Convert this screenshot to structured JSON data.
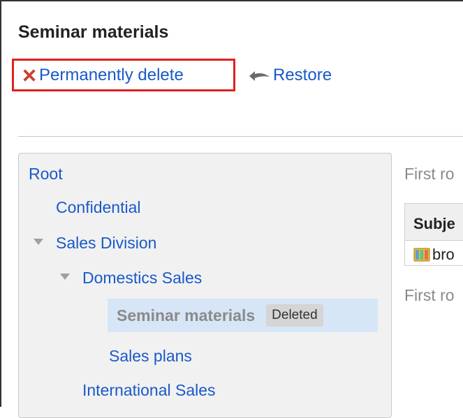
{
  "page": {
    "title": "Seminar materials"
  },
  "toolbar": {
    "delete_label": "Permanently delete",
    "restore_label": "Restore"
  },
  "tree": {
    "root": "Root",
    "confidential": "Confidential",
    "sales_division": "Sales Division",
    "domestics_sales": "Domestics Sales",
    "seminar_materials": "Seminar materials",
    "deleted_badge": "Deleted",
    "sales_plans": "Sales plans",
    "international_sales": "International Sales"
  },
  "content": {
    "first_row_top": "First ro",
    "first_row_bottom": "First ro",
    "table": {
      "header": "Subje",
      "cell": "bro"
    }
  },
  "colors": {
    "link": "#1a59c9",
    "highlight_border": "#e02020",
    "selected_bg": "#d6e6f7",
    "delete_icon": "#d9422f"
  },
  "icons": [
    "x-icon",
    "restore-icon",
    "caret-down-icon",
    "binder-icon"
  ]
}
